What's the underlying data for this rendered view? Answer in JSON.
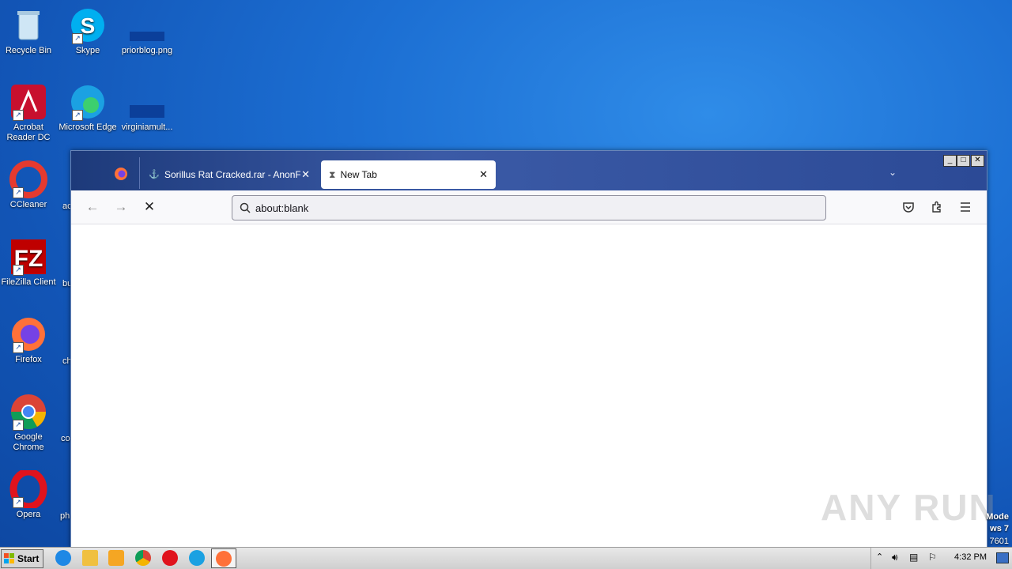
{
  "desktop": {
    "icons": [
      {
        "label": "Recycle Bin"
      },
      {
        "label": "Skype"
      },
      {
        "label": "priorblog.png"
      },
      {
        "label": "Acrobat Reader DC"
      },
      {
        "label": "Microsoft Edge"
      },
      {
        "label": "virginiamult..."
      },
      {
        "label": "CCleaner"
      },
      {
        "label": "FileZilla Client"
      },
      {
        "label": "Firefox"
      },
      {
        "label": "Google Chrome"
      },
      {
        "label": "Opera"
      }
    ],
    "partial_labels": [
      "ac",
      "bu",
      "ch",
      "co",
      "ph"
    ]
  },
  "browser": {
    "tabs": [
      {
        "title": "Sorillus Rat Cracked.rar - AnonFiles"
      },
      {
        "title": "New Tab"
      }
    ],
    "url": "about:blank"
  },
  "taskbar": {
    "start_label": "Start",
    "clock": "4:32 PM"
  },
  "watermark": "ANY RUN",
  "side_text": [
    "Mode",
    "ws 7",
    "7601"
  ]
}
